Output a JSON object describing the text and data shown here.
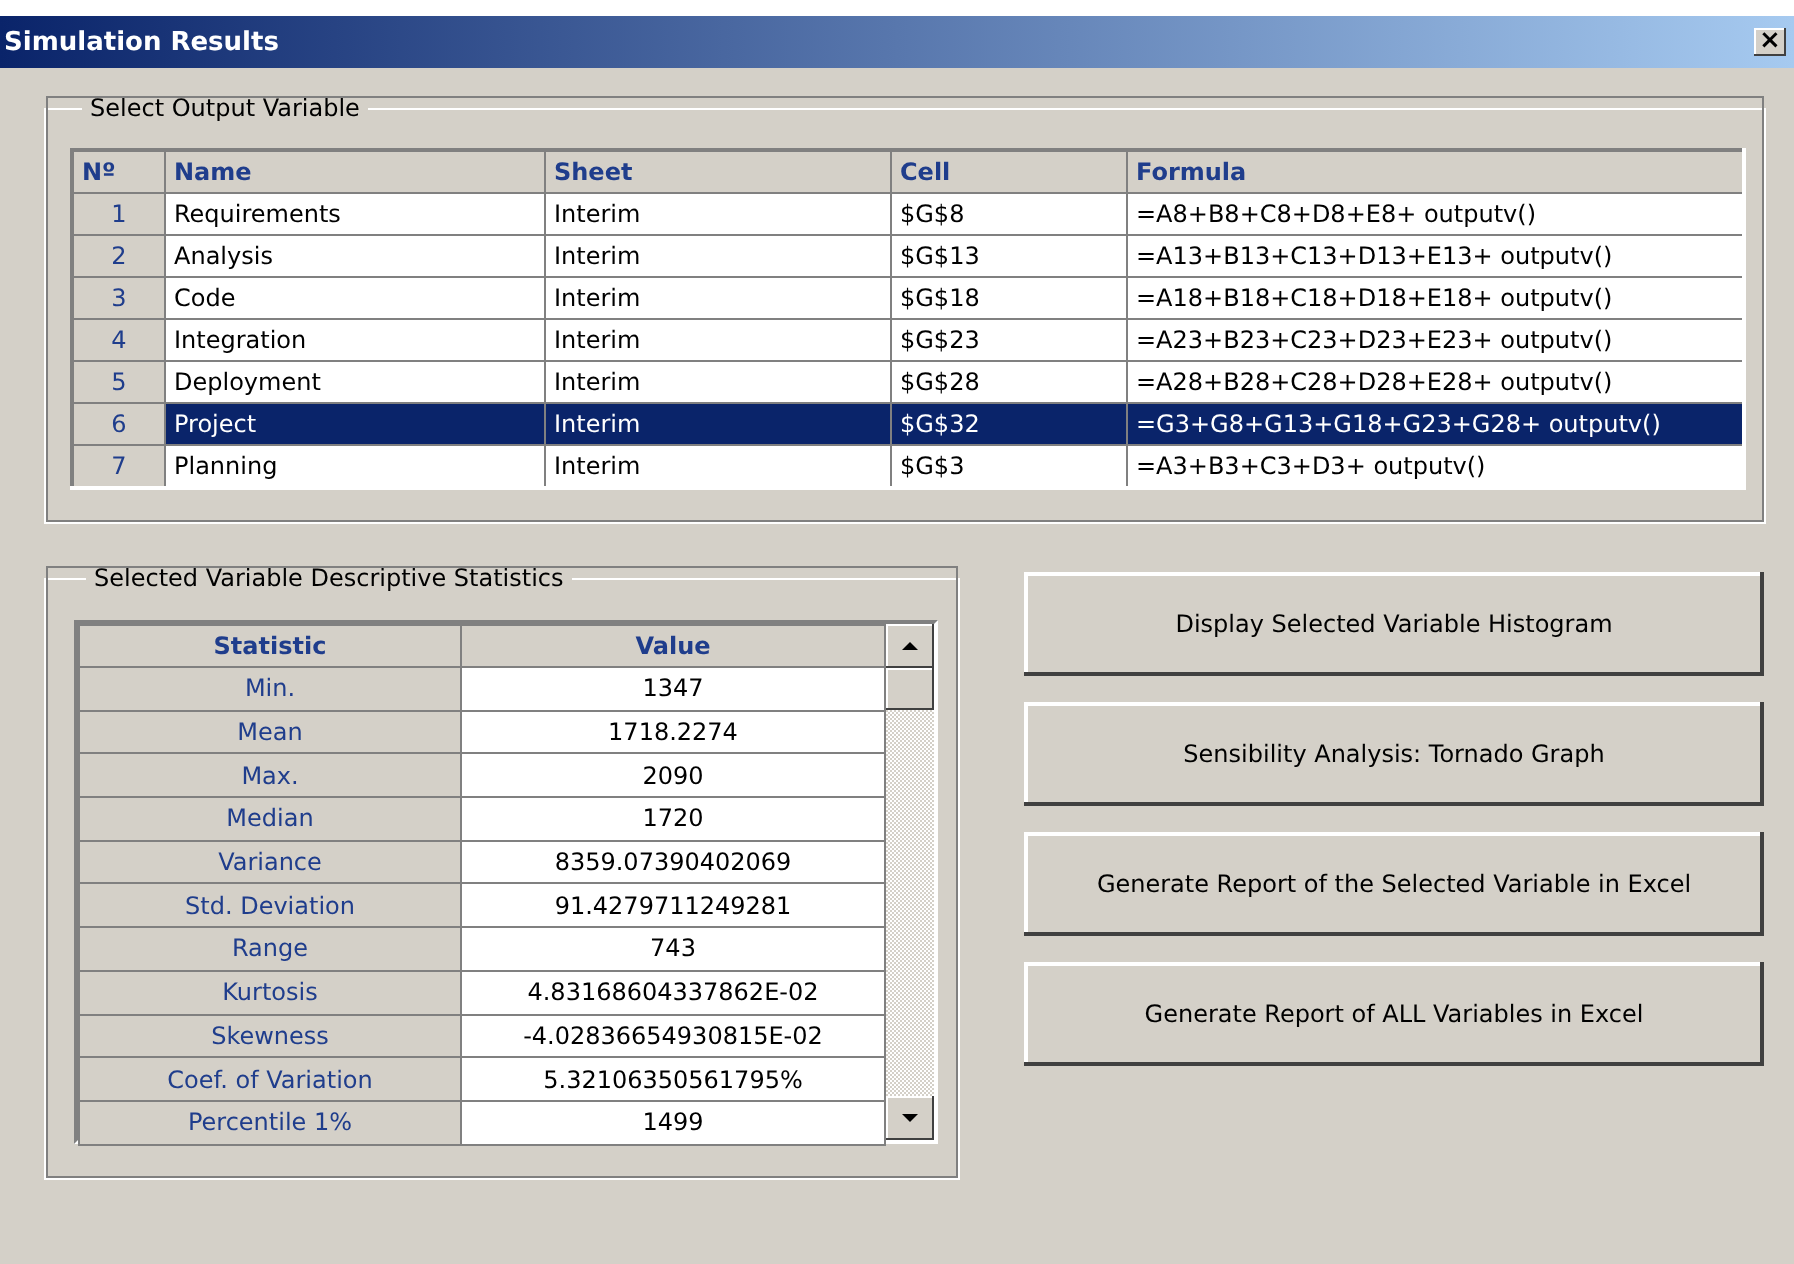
{
  "window": {
    "title": "Simulation Results",
    "close": "×"
  },
  "output_group": {
    "legend": "Select Output Variable",
    "columns": [
      "Nº",
      "Name",
      "Sheet",
      "Cell",
      "Formula"
    ],
    "rows": [
      {
        "no": "1",
        "name": "Requirements",
        "sheet": "Interim",
        "cell": "$G$8",
        "formula": "=A8+B8+C8+D8+E8+ outputv()",
        "selected": false
      },
      {
        "no": "2",
        "name": "Analysis",
        "sheet": "Interim",
        "cell": "$G$13",
        "formula": "=A13+B13+C13+D13+E13+ outputv()",
        "selected": false
      },
      {
        "no": "3",
        "name": "Code",
        "sheet": "Interim",
        "cell": "$G$18",
        "formula": "=A18+B18+C18+D18+E18+ outputv()",
        "selected": false
      },
      {
        "no": "4",
        "name": "Integration",
        "sheet": "Interim",
        "cell": "$G$23",
        "formula": "=A23+B23+C23+D23+E23+ outputv()",
        "selected": false
      },
      {
        "no": "5",
        "name": "Deployment",
        "sheet": "Interim",
        "cell": "$G$28",
        "formula": "=A28+B28+C28+D28+E28+ outputv()",
        "selected": false
      },
      {
        "no": "6",
        "name": "Project",
        "sheet": "Interim",
        "cell": "$G$32",
        "formula": "=G3+G8+G13+G18+G23+G28+ outputv()",
        "selected": true
      },
      {
        "no": "7",
        "name": "Planning",
        "sheet": "Interim",
        "cell": "$G$3",
        "formula": "=A3+B3+C3+D3+ outputv()",
        "selected": false
      }
    ]
  },
  "stats_group": {
    "legend": "Selected Variable Descriptive Statistics",
    "columns": [
      "Statistic",
      "Value"
    ],
    "rows": [
      {
        "statistic": "Min.",
        "value": "1347"
      },
      {
        "statistic": "Mean",
        "value": "1718.2274"
      },
      {
        "statistic": "Max.",
        "value": "2090"
      },
      {
        "statistic": "Median",
        "value": "1720"
      },
      {
        "statistic": "Variance",
        "value": "8359.07390402069"
      },
      {
        "statistic": "Std. Deviation",
        "value": "91.4279711249281"
      },
      {
        "statistic": "Range",
        "value": "743"
      },
      {
        "statistic": "Kurtosis",
        "value": "4.83168604337862E-02"
      },
      {
        "statistic": "Skewness",
        "value": "-4.02836654930815E-02"
      },
      {
        "statistic": "Coef. of Variation",
        "value": "5.32106350561795%"
      },
      {
        "statistic": "Percentile 1%",
        "value": "1499"
      }
    ]
  },
  "buttons": [
    "Display Selected Variable Histogram",
    "Sensibility Analysis: Tornado Graph",
    "Generate Report of the Selected Variable in Excel",
    "Generate Report of ALL Variables in Excel"
  ]
}
